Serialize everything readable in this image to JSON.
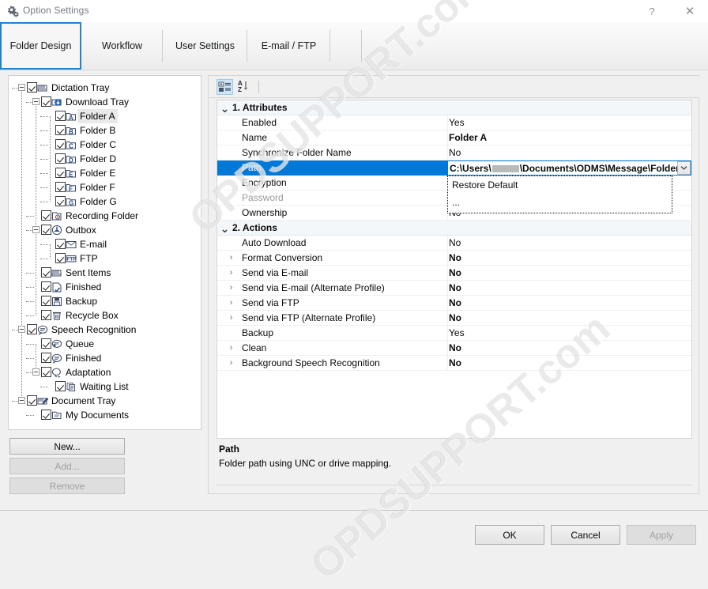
{
  "window": {
    "title": "Option Settings",
    "icon": "gears-icon",
    "help_label": "?",
    "close_label": "✕"
  },
  "tabs": [
    {
      "label": "Folder Design",
      "active": true
    },
    {
      "label": "Workflow",
      "active": false
    },
    {
      "label": "User Settings",
      "active": false
    },
    {
      "label": "E-mail / FTP",
      "active": false
    }
  ],
  "tree": {
    "nodes": [
      {
        "label": "Dictation Tray",
        "depth": 0,
        "checked": true,
        "expander": "minus",
        "icon": "tray-icon",
        "selected": false
      },
      {
        "label": "Download Tray",
        "depth": 1,
        "checked": true,
        "expander": "minus",
        "icon": "download-tray-icon",
        "selected": false
      },
      {
        "label": "Folder A",
        "depth": 2,
        "checked": true,
        "expander": "none",
        "icon": "folder-a-icon",
        "selected": true
      },
      {
        "label": "Folder B",
        "depth": 2,
        "checked": true,
        "expander": "none",
        "icon": "folder-b-icon",
        "selected": false
      },
      {
        "label": "Folder C",
        "depth": 2,
        "checked": true,
        "expander": "none",
        "icon": "folder-c-icon",
        "selected": false
      },
      {
        "label": "Folder D",
        "depth": 2,
        "checked": true,
        "expander": "none",
        "icon": "folder-d-icon",
        "selected": false
      },
      {
        "label": "Folder E",
        "depth": 2,
        "checked": true,
        "expander": "none",
        "icon": "folder-e-icon",
        "selected": false
      },
      {
        "label": "Folder F",
        "depth": 2,
        "checked": true,
        "expander": "none",
        "icon": "folder-f-icon",
        "selected": false
      },
      {
        "label": "Folder G",
        "depth": 2,
        "checked": true,
        "expander": "none",
        "icon": "folder-g-icon",
        "selected": false
      },
      {
        "label": "Recording Folder",
        "depth": 1,
        "checked": true,
        "expander": "none",
        "icon": "recording-folder-icon",
        "selected": false
      },
      {
        "label": "Outbox",
        "depth": 1,
        "checked": true,
        "expander": "minus",
        "icon": "outbox-icon",
        "selected": false
      },
      {
        "label": "E-mail",
        "depth": 2,
        "checked": true,
        "expander": "none",
        "icon": "envelope-icon",
        "selected": false
      },
      {
        "label": "FTP",
        "depth": 2,
        "checked": true,
        "expander": "none",
        "icon": "ftp-icon",
        "selected": false
      },
      {
        "label": "Sent Items",
        "depth": 1,
        "checked": true,
        "expander": "none",
        "icon": "sent-items-icon",
        "selected": false
      },
      {
        "label": "Finished",
        "depth": 1,
        "checked": true,
        "expander": "none",
        "icon": "finished-icon",
        "selected": false
      },
      {
        "label": "Backup",
        "depth": 1,
        "checked": true,
        "expander": "none",
        "icon": "backup-icon",
        "selected": false
      },
      {
        "label": "Recycle Box",
        "depth": 1,
        "checked": true,
        "expander": "none",
        "icon": "recycle-bin-icon",
        "selected": false
      },
      {
        "label": "Speech Recognition",
        "depth": 0,
        "checked": true,
        "expander": "minus",
        "icon": "speech-bubble-icon",
        "selected": false
      },
      {
        "label": "Queue",
        "depth": 1,
        "checked": true,
        "expander": "none",
        "icon": "queue-icon",
        "selected": false
      },
      {
        "label": "Finished",
        "depth": 1,
        "checked": true,
        "expander": "none",
        "icon": "finished-speech-icon",
        "selected": false
      },
      {
        "label": "Adaptation",
        "depth": 1,
        "checked": true,
        "expander": "minus",
        "icon": "adaptation-icon",
        "selected": false
      },
      {
        "label": "Waiting List",
        "depth": 2,
        "checked": true,
        "expander": "none",
        "icon": "waiting-list-icon",
        "selected": false
      },
      {
        "label": "Document Tray",
        "depth": 0,
        "checked": true,
        "expander": "minus",
        "icon": "document-tray-icon",
        "selected": false
      },
      {
        "label": "My Documents",
        "depth": 1,
        "checked": true,
        "expander": "none",
        "icon": "my-documents-icon",
        "selected": false
      }
    ]
  },
  "tree_buttons": [
    {
      "label": "New...",
      "enabled": true
    },
    {
      "label": "Add...",
      "enabled": false
    },
    {
      "label": "Remove",
      "enabled": false
    }
  ],
  "property_toolbar": {
    "categorized_label": "categorized-view-icon",
    "alphabetical_label": "alphabetical-sort-icon",
    "categorized_active": true
  },
  "grid": {
    "rows": [
      {
        "kind": "category",
        "name": "1. Attributes",
        "value": "",
        "chevron": "down"
      },
      {
        "kind": "prop",
        "name": "Enabled",
        "value": "Yes",
        "bold": false,
        "chevron": "none",
        "disabled": false
      },
      {
        "kind": "prop",
        "name": "Name",
        "value": "Folder A",
        "bold": true,
        "chevron": "none",
        "disabled": false
      },
      {
        "kind": "prop",
        "name": "Synchronize Folder Name",
        "value": "No",
        "bold": false,
        "chevron": "none",
        "disabled": false
      },
      {
        "kind": "editing",
        "name": "Path",
        "value": "",
        "bold": true,
        "chevron": "none",
        "disabled": false
      },
      {
        "kind": "prop",
        "name": "Encryption",
        "value": "",
        "bold": false,
        "chevron": "none",
        "disabled": false
      },
      {
        "kind": "prop",
        "name": "Password",
        "value": "",
        "bold": false,
        "chevron": "none",
        "disabled": true
      },
      {
        "kind": "prop",
        "name": "Ownership",
        "value": "No",
        "bold": false,
        "chevron": "none",
        "disabled": false
      },
      {
        "kind": "category",
        "name": "2. Actions",
        "value": "",
        "chevron": "down"
      },
      {
        "kind": "prop",
        "name": "Auto Download",
        "value": "No",
        "bold": false,
        "chevron": "none",
        "disabled": false
      },
      {
        "kind": "prop",
        "name": "Format Conversion",
        "value": "No",
        "bold": true,
        "chevron": "right",
        "disabled": false
      },
      {
        "kind": "prop",
        "name": "Send via E-mail",
        "value": "No",
        "bold": true,
        "chevron": "right",
        "disabled": false
      },
      {
        "kind": "prop",
        "name": "Send via E-mail (Alternate Profile)",
        "value": "No",
        "bold": true,
        "chevron": "right",
        "disabled": false
      },
      {
        "kind": "prop",
        "name": "Send via FTP",
        "value": "No",
        "bold": true,
        "chevron": "right",
        "disabled": false
      },
      {
        "kind": "prop",
        "name": "Send via FTP (Alternate Profile)",
        "value": "No",
        "bold": true,
        "chevron": "right",
        "disabled": false
      },
      {
        "kind": "prop",
        "name": "Backup",
        "value": "Yes",
        "bold": false,
        "chevron": "none",
        "disabled": false
      },
      {
        "kind": "prop",
        "name": "Clean",
        "value": "No",
        "bold": true,
        "chevron": "right",
        "disabled": false
      },
      {
        "kind": "prop",
        "name": "Background Speech Recognition",
        "value": "No",
        "bold": true,
        "chevron": "right",
        "disabled": false
      }
    ]
  },
  "path_editor": {
    "prefix": "C:\\Users\\",
    "suffix": "\\Documents\\ODMS\\Message\\FolderA",
    "redacted": true,
    "dropdown_open": true,
    "dropdown_icon": "chevron-down-icon",
    "options": [
      {
        "label": "Restore Default"
      },
      {
        "label": "..."
      }
    ]
  },
  "description": {
    "title": "Path",
    "text": "Folder path using UNC or drive mapping."
  },
  "dialog_buttons": [
    {
      "label": "OK",
      "enabled": true
    },
    {
      "label": "Cancel",
      "enabled": true
    },
    {
      "label": "Apply",
      "enabled": false
    }
  ],
  "watermark": {
    "text": "OPDSUPPORT.com"
  },
  "colors": {
    "selection": "#0078d7",
    "tab_active_border": "#2a7fc9",
    "window_bg": "#f0f0f0",
    "panel_bg": "#ffffff"
  }
}
